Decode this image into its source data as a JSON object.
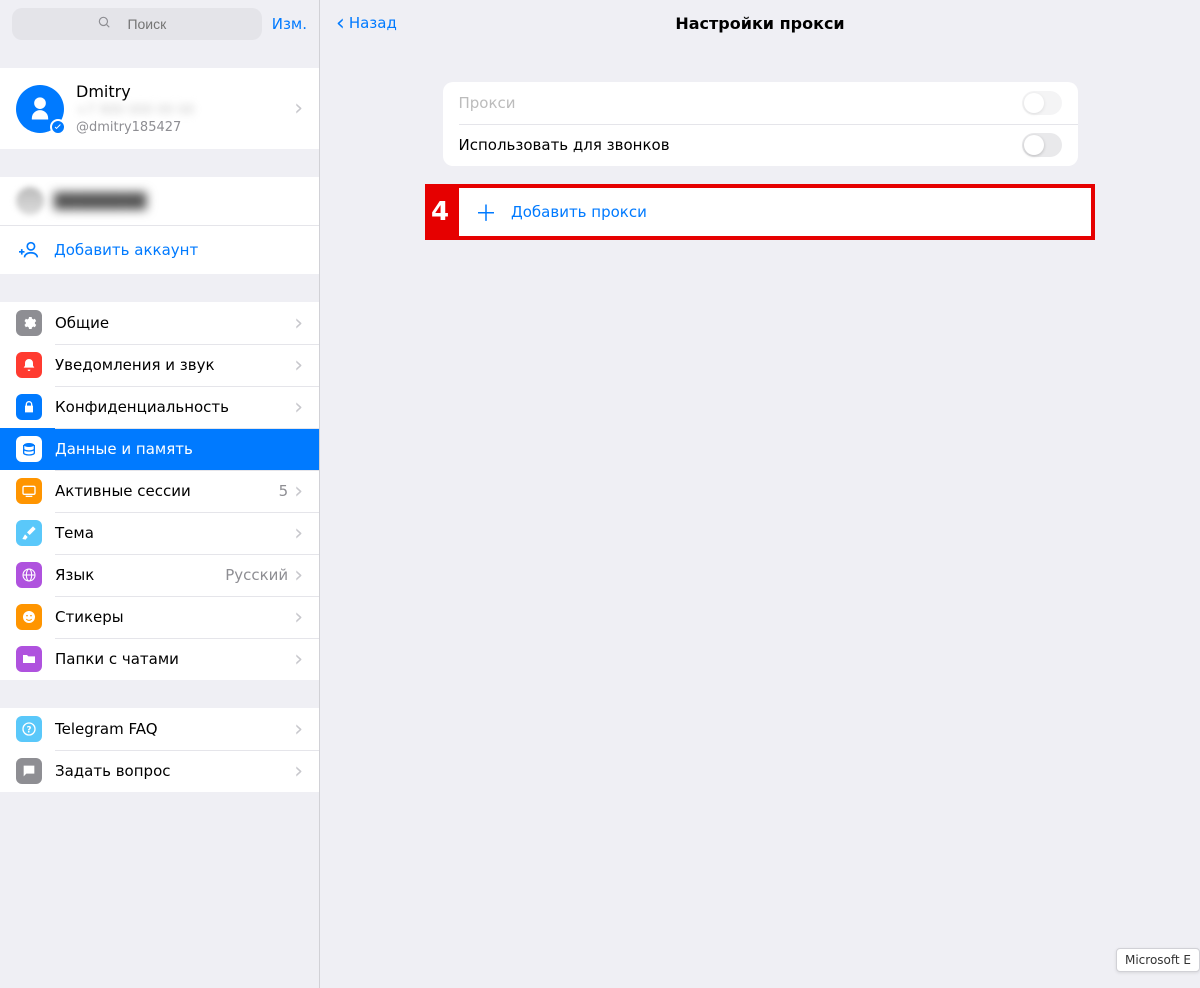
{
  "sidebar": {
    "search_placeholder": "Поиск",
    "edit_label": "Изм.",
    "profile": {
      "name": "Dmitry",
      "handle": "@dmitry185427"
    },
    "add_account_label": "Добавить аккаунт",
    "menu": {
      "general": "Общие",
      "notifications": "Уведомления и звук",
      "privacy": "Конфиденциальность",
      "data": "Данные и память",
      "sessions": "Активные сессии",
      "sessions_count": "5",
      "theme": "Тема",
      "language": "Язык",
      "language_value": "Русский",
      "stickers": "Стикеры",
      "folders": "Папки с чатами",
      "faq": "Telegram FAQ",
      "ask": "Задать вопрос"
    }
  },
  "main": {
    "back_label": "Назад",
    "title": "Настройки прокси",
    "proxy_label": "Прокси",
    "calls_label": "Использовать для звонков",
    "add_proxy_label": "Добавить прокси",
    "callout_number": "4"
  },
  "tooltip_text": "Microsoft E"
}
